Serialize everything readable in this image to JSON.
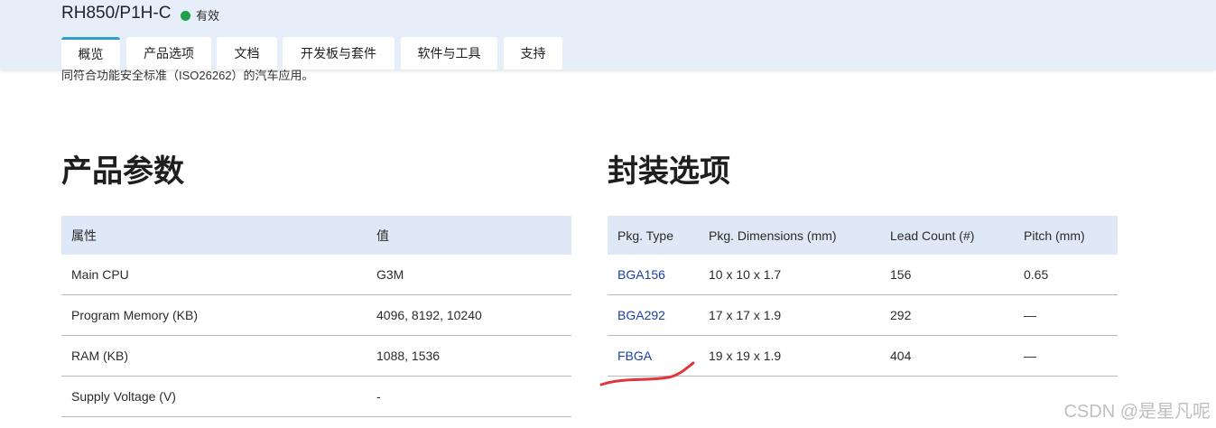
{
  "header": {
    "product_title": "RH850/P1H-C",
    "status": "有效",
    "tabs": [
      "概览",
      "产品选项",
      "文档",
      "开发板与套件",
      "软件与工具",
      "支持"
    ]
  },
  "intro_text": "同符合功能安全标准（ISO26262）的汽车应用。",
  "params": {
    "title": "产品参数",
    "headers": [
      "属性",
      "值"
    ],
    "rows": [
      [
        "Main CPU",
        "G3M"
      ],
      [
        "Program Memory (KB)",
        "4096, 8192, 10240"
      ],
      [
        "RAM (KB)",
        "1088, 1536"
      ],
      [
        "Supply Voltage (V)",
        "-"
      ]
    ]
  },
  "packages": {
    "title": "封装选项",
    "headers": [
      "Pkg. Type",
      "Pkg. Dimensions (mm)",
      "Lead Count (#)",
      "Pitch (mm)"
    ],
    "rows": [
      [
        "BGA156",
        "10 x 10 x 1.7",
        "156",
        "0.65"
      ],
      [
        "BGA292",
        "17 x 17 x 1.9",
        "292",
        "—"
      ],
      [
        "FBGA",
        "19 x 19 x 1.9",
        "404",
        "—"
      ]
    ]
  },
  "watermark": "CSDN @是星凡呢",
  "colors": {
    "accent": "#2a9fc9",
    "status_dot": "#20a04a",
    "link": "#1a3fa5",
    "annotation": "#e0373d"
  }
}
